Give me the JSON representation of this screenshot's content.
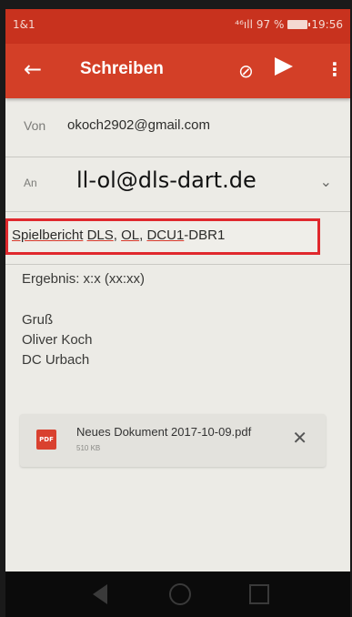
{
  "statusbar": {
    "carrier": "1&1",
    "signal": "⁴⁶ıll",
    "battery": "97 %",
    "time": "19:56"
  },
  "toolbar": {
    "back_icon": "arrow-left-icon",
    "title": "Schreiben",
    "attach_icon": "paperclip-icon",
    "send_icon": "send-icon",
    "more_icon": "more-vert-icon"
  },
  "compose": {
    "from_label": "Von",
    "from_value": "okoch2902@gmail.com",
    "to_label": "An",
    "to_value": "ll-ol@dls-dart.de",
    "subject_parts": [
      "Spielbericht",
      " ",
      "DLS",
      ", ",
      "OL",
      ", ",
      "DCU1",
      "-DBR1"
    ],
    "body": {
      "result": "Ergebnis: x:x (xx:xx)",
      "line1": "Gruß",
      "line2": "Oliver Koch",
      "line3": "DC Urbach"
    }
  },
  "attachment": {
    "type_label": "PDF",
    "name": "Neues Dokument 2017-10-09.pdf",
    "size": "510 KB"
  },
  "colors": {
    "toolbar": "#d33f27",
    "statusbar": "#c8321e",
    "highlight": "#e0282d"
  }
}
